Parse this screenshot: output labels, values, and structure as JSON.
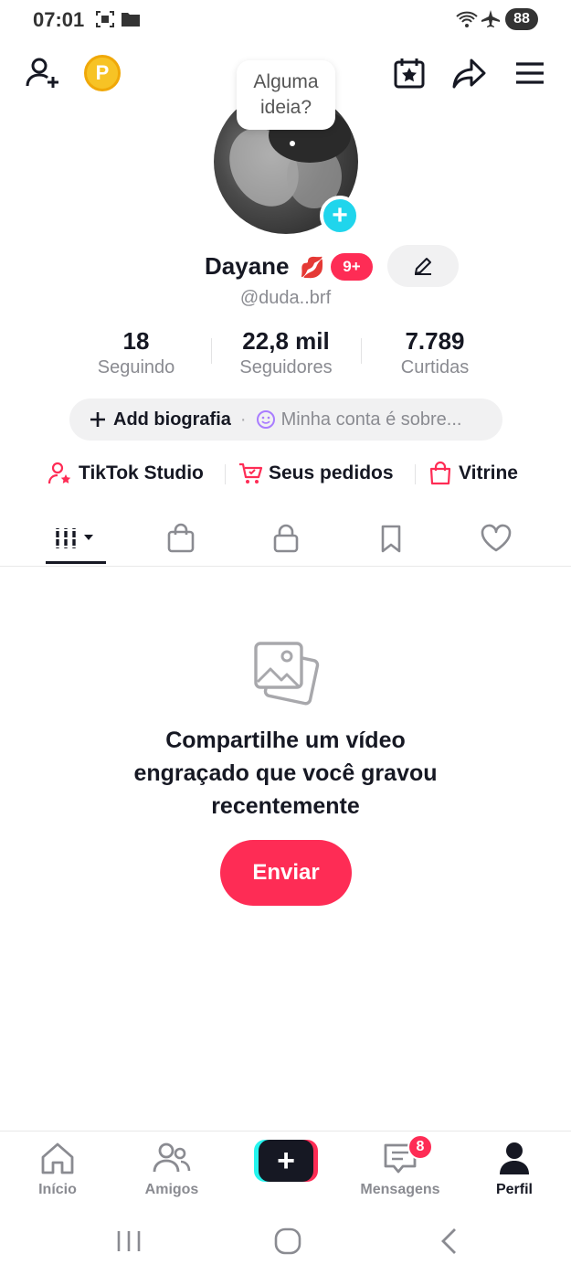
{
  "status_bar": {
    "time": "07:01",
    "battery": "88"
  },
  "header": {
    "coin_label": "P",
    "idea_bubble": "Alguma ideia?"
  },
  "profile": {
    "name": "Dayane",
    "emoji": "💋",
    "badge": "9+",
    "handle": "@duda..brf",
    "add_avatar": "+"
  },
  "stats": [
    {
      "value": "18",
      "label": "Seguindo"
    },
    {
      "value": "22,8 mil",
      "label": "Seguidores"
    },
    {
      "value": "7.789",
      "label": "Curtidas"
    }
  ],
  "bio": {
    "add_label": "Add biografia",
    "separator": "·",
    "hint": "Minha conta é sobre..."
  },
  "links": [
    {
      "label": "TikTok Studio",
      "icon": "user-star-icon"
    },
    {
      "label": "Seus pedidos",
      "icon": "cart-icon"
    },
    {
      "label": "Vitrine",
      "icon": "shopping-bag-icon"
    }
  ],
  "tabs": [
    {
      "name": "videos-grid",
      "icon": "grid-icon",
      "active": true
    },
    {
      "name": "shop",
      "icon": "bag-icon"
    },
    {
      "name": "private",
      "icon": "lock-icon"
    },
    {
      "name": "saved",
      "icon": "bookmark-icon"
    },
    {
      "name": "liked",
      "icon": "heart-icon"
    }
  ],
  "empty_state": {
    "message_line1": "Compartilhe um vídeo",
    "message_line2": "engraçado que você gravou",
    "message_line3": "recentemente",
    "button_label": "Enviar"
  },
  "bottom_nav": {
    "home": "Início",
    "friends": "Amigos",
    "create": "+",
    "messages": "Mensagens",
    "messages_badge": "8",
    "profile": "Perfil"
  },
  "colors": {
    "accent": "#fe2c55",
    "cyan": "#25f4ee",
    "text": "#161823",
    "muted": "#8a8b91"
  }
}
